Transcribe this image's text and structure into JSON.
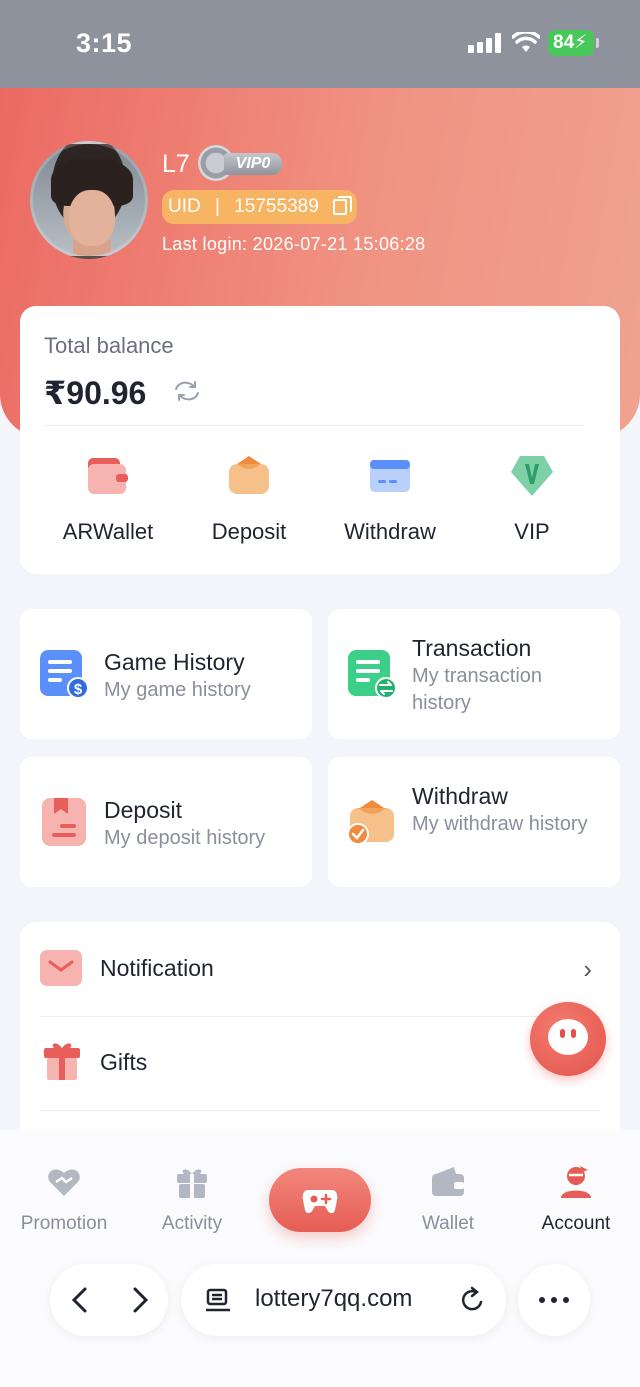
{
  "status_bar": {
    "time": "3:15",
    "battery": "84"
  },
  "profile": {
    "username": "L7",
    "vip_badge": "VIP0",
    "uid_label": "UID",
    "uid_separator": "|",
    "uid_value": "15755389",
    "last_login": "Last login: 2026-07-21 15:06:28"
  },
  "balance": {
    "label": "Total balance",
    "value": "₹90.96",
    "actions": [
      {
        "label": "ARWallet",
        "icon": "wallet-icon"
      },
      {
        "label": "Deposit",
        "icon": "deposit-icon"
      },
      {
        "label": "Withdraw",
        "icon": "card-icon"
      },
      {
        "label": "VIP",
        "icon": "vip-icon"
      }
    ]
  },
  "history_cards": [
    {
      "title": "Game History",
      "subtitle": "My game history",
      "icon": "game-history-icon",
      "color": "#5b8ff9"
    },
    {
      "title": "Transaction",
      "subtitle": "My transaction history",
      "icon": "transaction-icon",
      "color": "#3ccf8a"
    },
    {
      "title": "Deposit",
      "subtitle": "My deposit history",
      "icon": "deposit-history-icon",
      "color": "#f08a86"
    },
    {
      "title": "Withdraw",
      "subtitle": "My withdraw history",
      "icon": "withdraw-history-icon",
      "color": "#f5a35c"
    }
  ],
  "menu": [
    {
      "label": "Notification",
      "icon": "mail-icon"
    },
    {
      "label": "Gifts",
      "icon": "gift-icon"
    }
  ],
  "tabbar": {
    "tabs": [
      {
        "label": "Promotion",
        "icon": "promotion-icon"
      },
      {
        "label": "Activity",
        "icon": "activity-icon"
      },
      {
        "label": "Wallet",
        "icon": "wallet-tab-icon"
      },
      {
        "label": "Account",
        "icon": "account-icon",
        "active": true
      }
    ],
    "center_icon": "gamepad-icon"
  },
  "browser": {
    "url": "lottery7qq.com"
  },
  "colors": {
    "accent": "#e65d55",
    "header_start": "#ec6a62",
    "header_end": "#f0a290",
    "uid_badge": "#f7b563"
  }
}
